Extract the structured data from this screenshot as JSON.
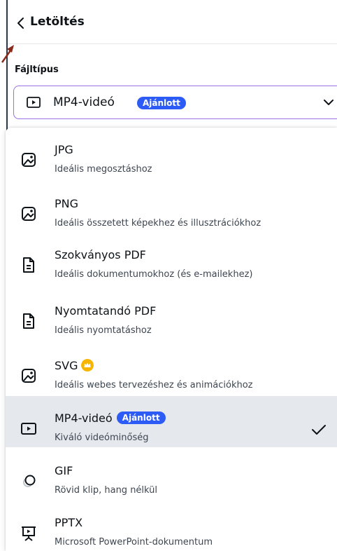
{
  "header": {
    "title": "Letöltés"
  },
  "file_type": {
    "label": "Fájltípus",
    "selected": "MP4-videó",
    "selected_badge": "Ajánlott"
  },
  "options": [
    {
      "name": "JPG",
      "desc": "Ideális megosztáshoz",
      "icon": "image-icon"
    },
    {
      "name": "PNG",
      "desc": "Ideális összetett képekhez és illusztrációkhoz",
      "icon": "image-icon"
    },
    {
      "name": "Szokványos PDF",
      "desc": "Ideális dokumentumokhoz (és e-mailekhez)",
      "icon": "document-icon"
    },
    {
      "name": "Nyomtatandó PDF",
      "desc": "Ideális nyomtatáshoz",
      "icon": "document-icon"
    },
    {
      "name": "SVG",
      "desc": "Ideális webes tervezéshez és animációkhoz",
      "icon": "image-icon",
      "premium": true
    },
    {
      "name": "MP4-videó",
      "badge": "Ajánlott",
      "desc": "Kiváló videóminőség",
      "icon": "video-icon",
      "selected": true
    },
    {
      "name": "GIF",
      "desc": "Rövid klip, hang nélkül",
      "icon": "gif-icon"
    },
    {
      "name": "PPTX",
      "desc": "Microsoft PowerPoint-dokumentum",
      "icon": "presentation-icon"
    }
  ],
  "colors": {
    "accent": "#2c5cf5",
    "select_border": "#9b6fe8",
    "selected_row": "#e5e8ed",
    "crown": "#f7b500",
    "cursor_arrow": "#8b2a1a"
  }
}
